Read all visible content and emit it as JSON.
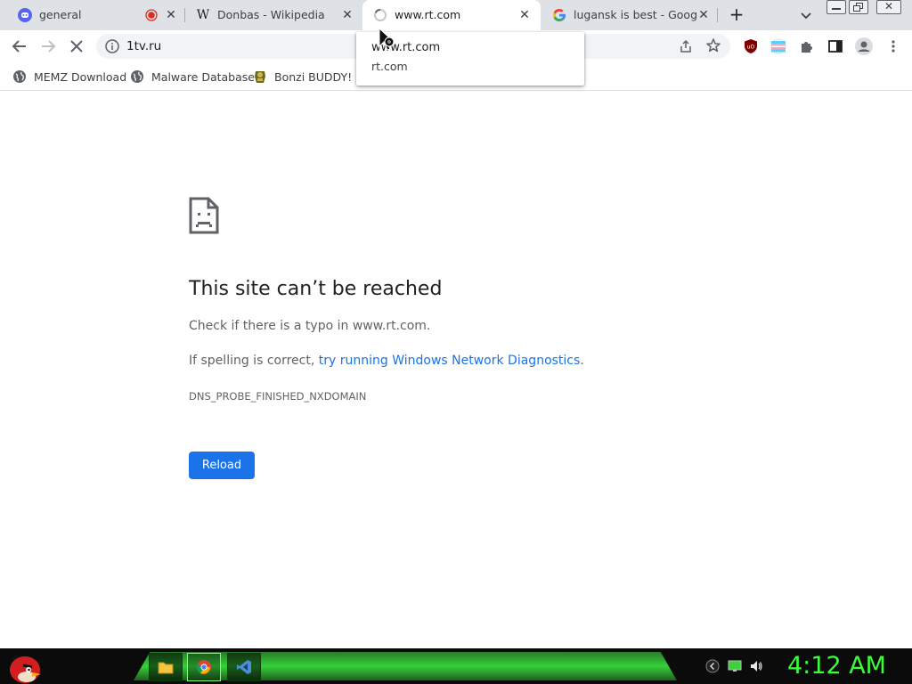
{
  "tabs": [
    {
      "title": "general",
      "favicon": "discord-icon",
      "recording": true
    },
    {
      "title": "Donbas - Wikipedia",
      "favicon": "wikipedia-icon"
    },
    {
      "title": "www.rt.com",
      "favicon": "loading-spinner-icon",
      "active": true
    },
    {
      "title": "lugansk is best - Google S",
      "favicon": "google-icon"
    }
  ],
  "new_tab_label": "+",
  "toolbar": {
    "url": "1tv.ru"
  },
  "bookmarks": [
    {
      "label": "MEMZ Download",
      "icon": "globe-icon"
    },
    {
      "label": "Malware Database",
      "icon": "globe-icon"
    },
    {
      "label": "Bonzi BUDDY!",
      "icon": "bonzi-icon"
    }
  ],
  "hover_card": {
    "title": "www.rt.com",
    "domain": "rt.com"
  },
  "error": {
    "title": "This site can’t be reached",
    "line1": "Check if there is a typo in www.rt.com.",
    "line2_prefix": "If spelling is correct, ",
    "line2_link": "try running Windows Network Diagnostics",
    "line2_suffix": ".",
    "code": "DNS_PROBE_FINISHED_NXDOMAIN",
    "reload_label": "Reload"
  },
  "taskbar": {
    "clock": "4:12 AM"
  },
  "colors": {
    "accent": "#1a73e8",
    "tabstrip": "#dee1e6",
    "clock": "#38ff38"
  }
}
